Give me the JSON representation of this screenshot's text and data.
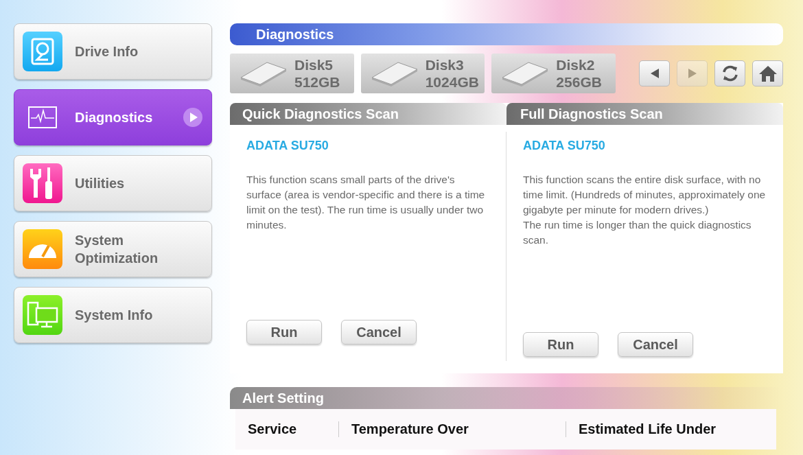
{
  "sidebar": {
    "items": [
      {
        "label": "Drive Info",
        "kind": "drive",
        "selected": false
      },
      {
        "label": "Diagnostics",
        "kind": "pulse",
        "selected": true
      },
      {
        "label": "Utilities",
        "kind": "tools",
        "selected": false
      },
      {
        "label": "System Optimization",
        "kind": "gauge",
        "selected": false
      },
      {
        "label": "System Info",
        "kind": "computer",
        "selected": false
      }
    ]
  },
  "header": {
    "title": "Diagnostics"
  },
  "disks": [
    {
      "name": "Disk5",
      "size": "512GB"
    },
    {
      "name": "Disk3",
      "size": "1024GB"
    },
    {
      "name": "Disk2",
      "size": "256GB"
    }
  ],
  "nav_buttons": [
    {
      "kind": "back",
      "disabled": false
    },
    {
      "kind": "forward",
      "disabled": true
    },
    {
      "kind": "refresh",
      "disabled": false
    },
    {
      "kind": "home",
      "disabled": false
    }
  ],
  "scans": [
    {
      "title": "Quick Diagnostics Scan",
      "drive": "ADATA SU750",
      "description": "This function scans small parts of the drive's surface (area is vendor-specific and there is a time limit on the test). The run time is usually under two minutes.",
      "buttons": [
        "Run",
        "Cancel"
      ]
    },
    {
      "title": "Full Diagnostics Scan",
      "drive": "ADATA SU750",
      "description": "This function scans the entire disk surface, with no time limit. (Hundreds of minutes, approximately one gigabyte per minute for modern drives.)\nThe run time is longer than the quick diagnostics scan.",
      "buttons": [
        "Run",
        "Cancel"
      ]
    }
  ],
  "alert": {
    "title": "Alert Setting",
    "columns": [
      "Service",
      "Temperature Over",
      "Estimated Life Under"
    ]
  }
}
